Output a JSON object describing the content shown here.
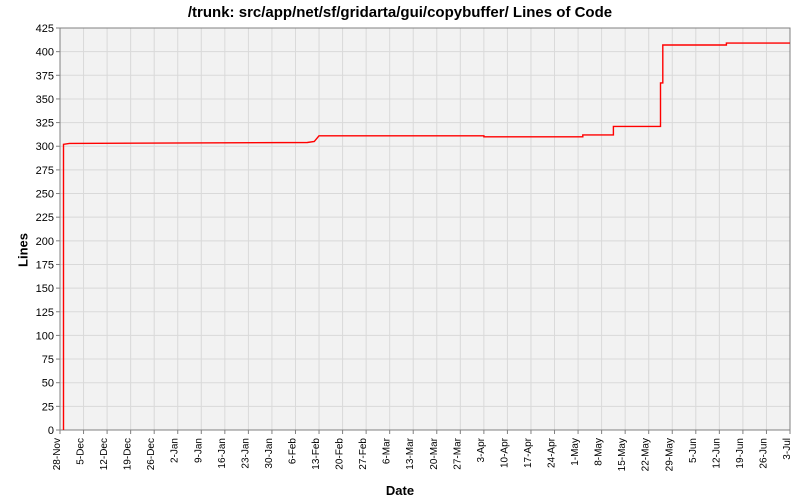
{
  "chart_data": {
    "type": "line",
    "title": "/trunk: src/app/net/sf/gridarta/gui/copybuffer/ Lines of Code",
    "xlabel": "Date",
    "ylabel": "Lines",
    "ylim": [
      0,
      425
    ],
    "y_ticks": [
      0,
      25,
      50,
      75,
      100,
      125,
      150,
      175,
      200,
      225,
      250,
      275,
      300,
      325,
      350,
      375,
      400,
      425
    ],
    "x_ticks": [
      "28-Nov",
      "5-Dec",
      "12-Dec",
      "19-Dec",
      "26-Dec",
      "2-Jan",
      "9-Jan",
      "16-Jan",
      "23-Jan",
      "30-Jan",
      "6-Feb",
      "13-Feb",
      "20-Feb",
      "27-Feb",
      "6-Mar",
      "13-Mar",
      "20-Mar",
      "27-Mar",
      "3-Apr",
      "10-Apr",
      "17-Apr",
      "24-Apr",
      "1-May",
      "8-May",
      "15-May",
      "22-May",
      "29-May",
      "5-Jun",
      "12-Jun",
      "19-Jun",
      "26-Jun",
      "3-Jul"
    ],
    "series": [
      {
        "name": "Lines of Code",
        "color": "#ff0000",
        "points": [
          {
            "x_index": 0.15,
            "y": 0
          },
          {
            "x_index": 0.15,
            "y": 302
          },
          {
            "x_index": 0.4,
            "y": 303
          },
          {
            "x_index": 10.5,
            "y": 304
          },
          {
            "x_index": 10.8,
            "y": 305
          },
          {
            "x_index": 11.0,
            "y": 311
          },
          {
            "x_index": 18.0,
            "y": 311
          },
          {
            "x_index": 18.0,
            "y": 310
          },
          {
            "x_index": 22.2,
            "y": 310
          },
          {
            "x_index": 22.2,
            "y": 312
          },
          {
            "x_index": 23.5,
            "y": 312
          },
          {
            "x_index": 23.5,
            "y": 321
          },
          {
            "x_index": 25.5,
            "y": 321
          },
          {
            "x_index": 25.5,
            "y": 367
          },
          {
            "x_index": 25.6,
            "y": 367
          },
          {
            "x_index": 25.6,
            "y": 407
          },
          {
            "x_index": 28.3,
            "y": 407
          },
          {
            "x_index": 28.3,
            "y": 409
          },
          {
            "x_index": 31.0,
            "y": 409
          }
        ]
      }
    ]
  }
}
